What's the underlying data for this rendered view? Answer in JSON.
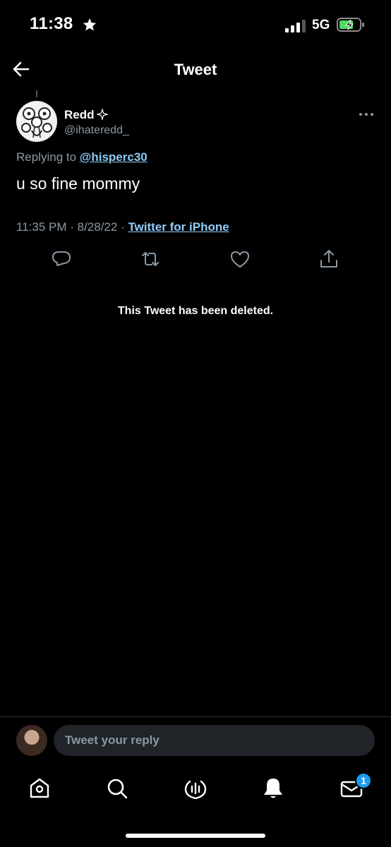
{
  "status_bar": {
    "time": "11:38",
    "network": "5G"
  },
  "header": {
    "title": "Tweet"
  },
  "tweet": {
    "display_name": "Redd",
    "handle": "@ihateredd_",
    "replying_prefix": "Replying to ",
    "replying_to": "@hisperc30",
    "text": "u so fine mommy",
    "timestamp": "11:35 PM · 8/28/22 · ",
    "source": "Twitter for iPhone",
    "notice": "This Tweet has been deleted."
  },
  "reply_bar": {
    "placeholder": "Tweet your reply"
  },
  "bottom_nav": {
    "notifications_badge": "1"
  },
  "icons": [
    "star-icon",
    "signal-icon",
    "battery-icon",
    "back-arrow-icon",
    "sparkle-icon",
    "more-icon",
    "reply-icon",
    "retweet-icon",
    "like-icon",
    "share-icon",
    "home-icon",
    "search-icon",
    "spaces-icon",
    "notifications-icon",
    "messages-icon"
  ],
  "colors": {
    "background": "#000000",
    "link": "#8ecdf8",
    "muted": "#8b98a5",
    "accent": "#1d9bf0",
    "battery": "#4cd964"
  }
}
